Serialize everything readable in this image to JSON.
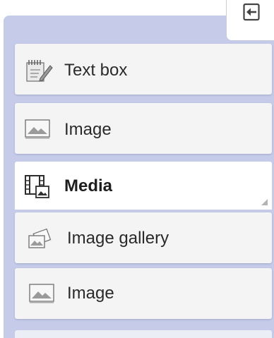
{
  "panel": {
    "background": "#c5cbe9",
    "collapse_button": {
      "icon": "collapse-panel-icon"
    },
    "items": [
      {
        "label": "Text box",
        "icon": "notepad-pencil-icon"
      },
      {
        "label": "Image",
        "icon": "image-icon"
      }
    ],
    "section": {
      "label": "Media",
      "icon": "media-film-icon"
    },
    "section_items": [
      {
        "label": "Image gallery",
        "icon": "image-gallery-icon"
      },
      {
        "label": "Image",
        "icon": "image-icon"
      }
    ]
  }
}
